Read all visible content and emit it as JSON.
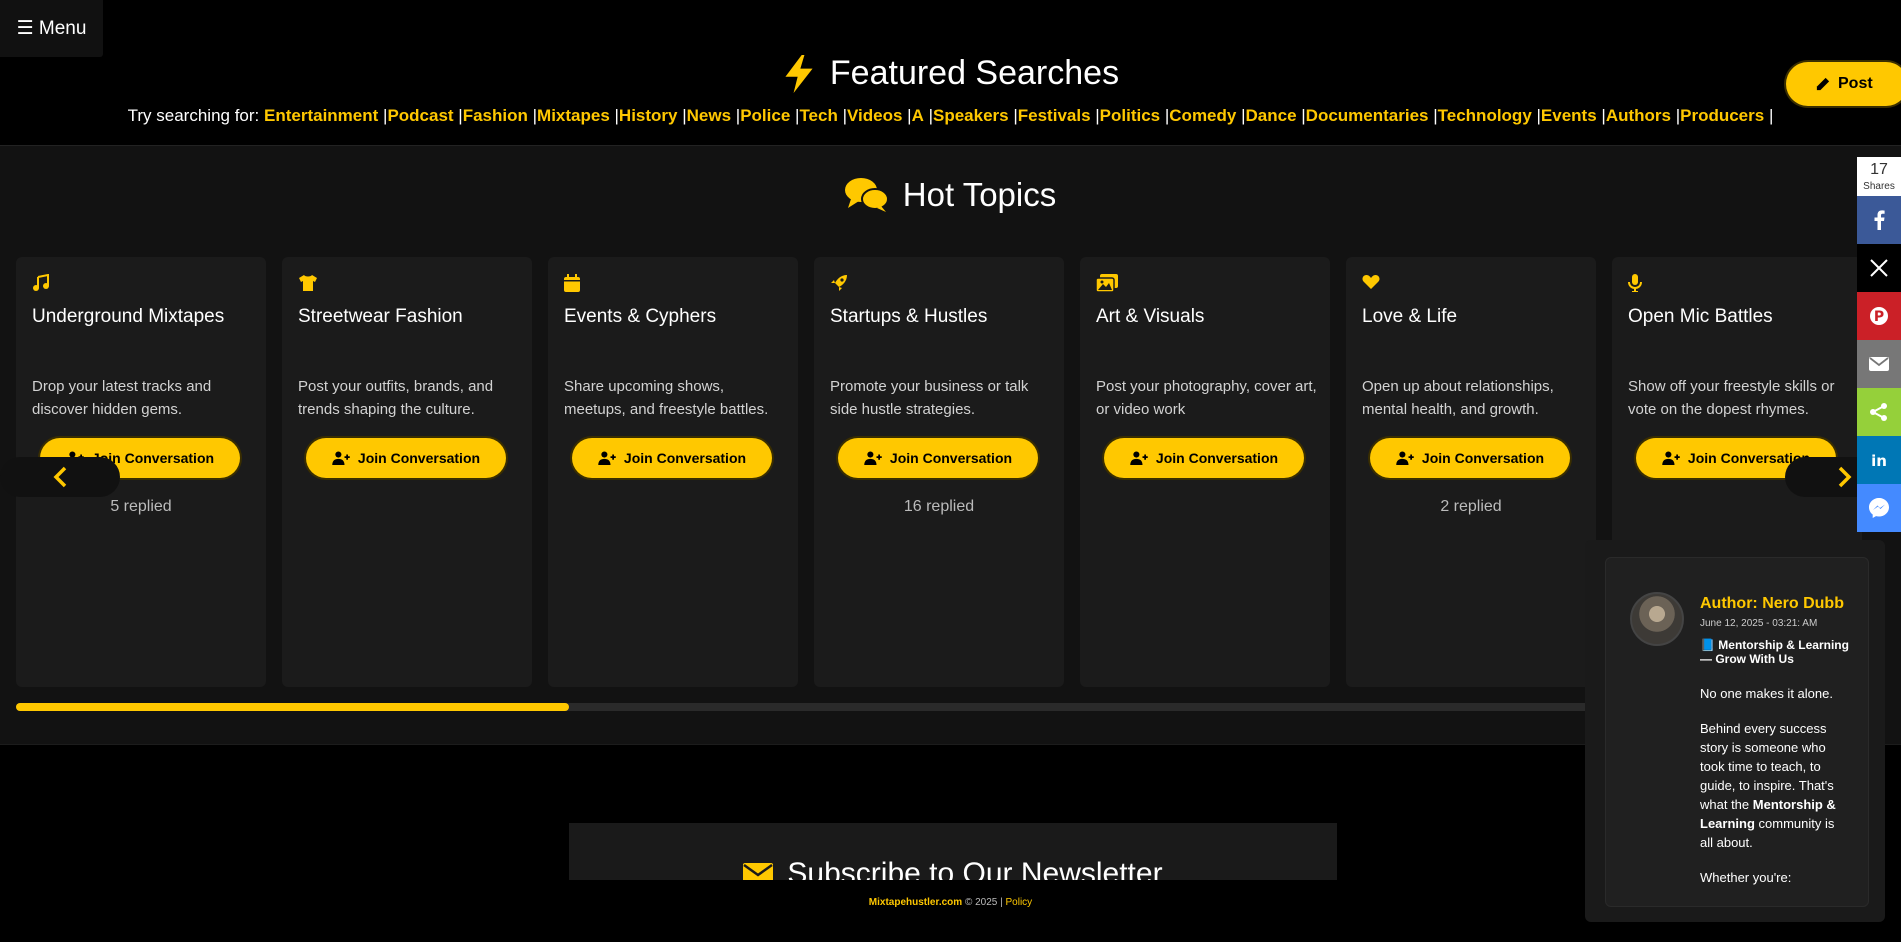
{
  "menu": {
    "label": "☰ Menu"
  },
  "featured": {
    "title": "Featured Searches",
    "try_label": "Try searching for:",
    "searches": [
      "Entertainment",
      "Podcast",
      "Fashion",
      "Mixtapes",
      "History",
      "News",
      "Police",
      "Tech",
      "Videos",
      "A",
      "Speakers",
      "Festivals",
      "Politics",
      "Comedy",
      "Dance",
      "Documentaries",
      "Technology",
      "Events",
      "Authors",
      "Producers"
    ]
  },
  "post": {
    "label": "Post"
  },
  "hot": {
    "title": "Hot Topics",
    "cards": [
      {
        "icon": "music-icon",
        "title": "Underground Mixtapes",
        "desc": "Drop your latest tracks and discover hidden gems.",
        "join": "Join Conversation",
        "replied": "5 replied"
      },
      {
        "icon": "shirt-icon",
        "title": "Streetwear Fashion",
        "desc": "Post your outfits, brands, and trends shaping the culture.",
        "join": "Join Conversation",
        "replied": ""
      },
      {
        "icon": "calendar-icon",
        "title": "Events & Cyphers",
        "desc": "Share upcoming shows, meetups, and freestyle battles.",
        "join": "Join Conversation",
        "replied": ""
      },
      {
        "icon": "rocket-icon",
        "title": "Startups & Hustles",
        "desc": "Promote your business or talk side hustle strategies.",
        "join": "Join Conversation",
        "replied": "16 replied"
      },
      {
        "icon": "images-icon",
        "title": "Art & Visuals",
        "desc": "Post your photography, cover art, or video work",
        "join": "Join Conversation",
        "replied": ""
      },
      {
        "icon": "heart-icon",
        "title": "Love & Life",
        "desc": "Open up about relationships, mental health, and growth.",
        "join": "Join Conversation",
        "replied": "2 replied"
      },
      {
        "icon": "microphone-icon",
        "title": "Open Mic Battles",
        "desc": "Show off your freestyle skills or vote on the dopest rhymes.",
        "join": "Join Conversation",
        "replied": ""
      }
    ],
    "progress": 0.296
  },
  "share": {
    "count": "17",
    "count_label": "Shares"
  },
  "author": {
    "name": "Author: Nero Dubb",
    "date": "June 12, 2025 - 03:21: AM",
    "topic": "📘 Mentorship & Learning — Grow With Us",
    "p1": "No one makes it alone.",
    "p2_a": "Behind every success story is someone who took time to teach, to guide, to inspire. That's what the ",
    "p2_b": "Mentorship & Learning",
    "p2_c": " community is all about.",
    "p3": "Whether you're:"
  },
  "newsletter": {
    "title": "Subscribe to Our Newsletter"
  },
  "footer": {
    "brand": "Mixtapehustler.com",
    "copyright": "© 2025 |",
    "policy": "Policy"
  },
  "colors": {
    "accent": "#ffc800",
    "background": "#000000",
    "card": "#1b1b1b"
  }
}
